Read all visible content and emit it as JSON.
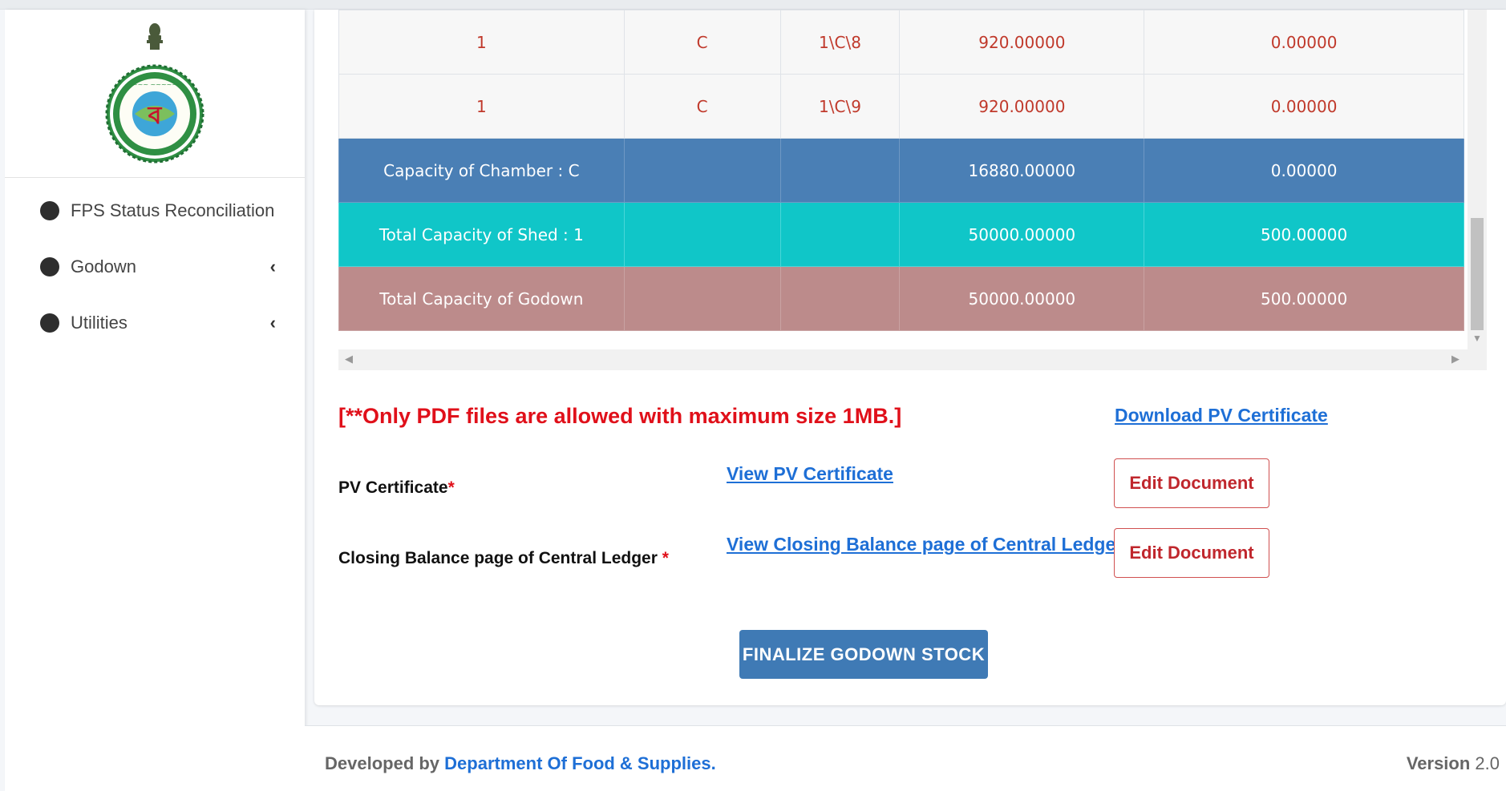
{
  "sidebar": {
    "logo_name": "West Bengal Government Emblem",
    "items": [
      {
        "label": "FPS Status Reconciliation",
        "has_submenu": false
      },
      {
        "label": "Godown",
        "has_submenu": true
      },
      {
        "label": "Utilities",
        "has_submenu": true
      }
    ]
  },
  "table": {
    "rows": [
      {
        "type": "data",
        "cells": [
          "1",
          "C",
          "1\\C\\8",
          "920.00000",
          "0.00000"
        ]
      },
      {
        "type": "data",
        "cells": [
          "1",
          "C",
          "1\\C\\9",
          "920.00000",
          "0.00000"
        ]
      },
      {
        "type": "chamber",
        "cells": [
          "Capacity of Chamber : C",
          "",
          "",
          "16880.00000",
          "0.00000"
        ]
      },
      {
        "type": "shed",
        "cells": [
          "Total Capacity of Shed : 1",
          "",
          "",
          "50000.00000",
          "500.00000"
        ]
      },
      {
        "type": "godown",
        "cells": [
          "Total Capacity of Godown",
          "",
          "",
          "50000.00000",
          "500.00000"
        ]
      }
    ]
  },
  "notice": "[**Only PDF files are allowed with maximum size 1MB.]",
  "download_link": "Download PV Certificate",
  "documents": [
    {
      "label": "PV Certificate",
      "required_mark": "*",
      "view_link": "View PV Certificate",
      "edit_label": "Edit Document"
    },
    {
      "label": "Closing Balance page of Central Ledger",
      "required_mark": " *",
      "view_link": "View Closing Balance page of Central Ledger",
      "edit_label": "Edit Document"
    }
  ],
  "finalize_label": "FINALIZE GODOWN STOCK",
  "footer": {
    "developed_by": "Developed by ",
    "department": "Department Of Food & Supplies.",
    "version_label": "Version",
    "version_number": " 2.0"
  },
  "colors": {
    "chamber_row": "#4a7fb5",
    "shed_row": "#10c6c8",
    "godown_row": "#bc8b8b",
    "link": "#1e6fd6",
    "notice": "#e0101a",
    "finalize_button": "#3f7ab5"
  },
  "icons": {
    "nav_bullet": "filled-circle-icon",
    "submenu": "chevron-left-icon",
    "scroll_left": "triangle-left-icon",
    "scroll_right": "triangle-right-icon",
    "scroll_down": "triangle-down-icon"
  }
}
